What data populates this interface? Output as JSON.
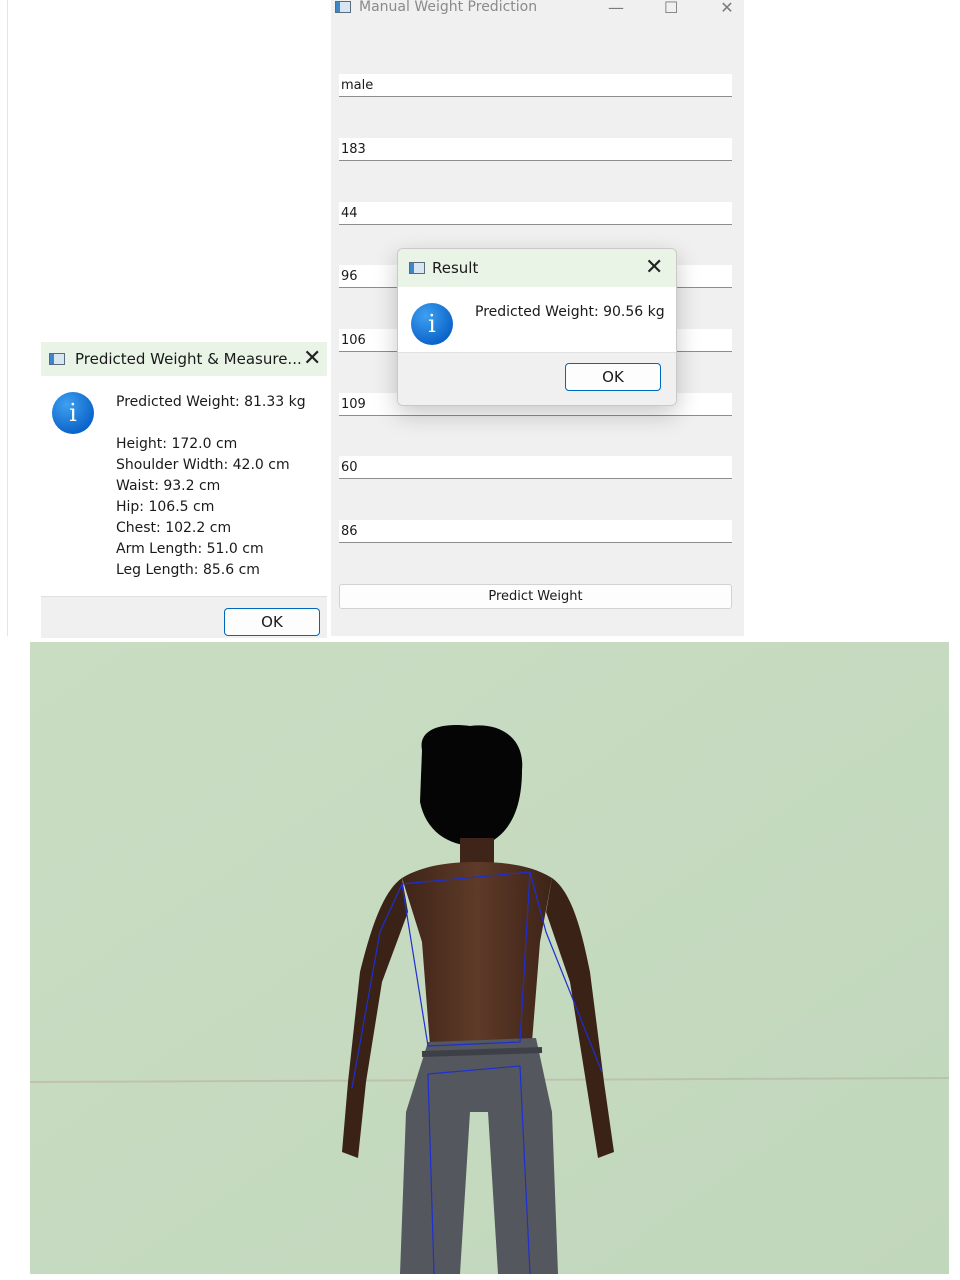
{
  "main_window": {
    "title": "Manual Weight Prediction",
    "fields": [
      "male",
      "183",
      "44",
      "96",
      "106",
      "109",
      "60",
      "86"
    ],
    "predict_button": "Predict Weight"
  },
  "result_dialog": {
    "title": "Result",
    "message": "Predicted Weight: 90.56 kg",
    "ok": "OK"
  },
  "measure_dialog": {
    "title": "Predicted Weight & Measure...",
    "predicted": "Predicted Weight: 81.33 kg",
    "lines": [
      "Height: 172.0 cm",
      "Shoulder Width: 42.0 cm",
      "Waist: 93.2 cm",
      "Hip: 106.5 cm",
      "Chest: 102.2 cm",
      "Arm Length: 51.0 cm",
      "Leg Length: 85.6 cm"
    ],
    "ok": "OK"
  },
  "icons": {
    "info": "i",
    "close": "✕",
    "minimize": "—",
    "maximize": "☐"
  },
  "colors": {
    "accent": "#0067c0",
    "dialog_title_bg": "#e9f4e6",
    "wall": "#c7dcc2",
    "overlay_lines": "#1e2fd0"
  }
}
